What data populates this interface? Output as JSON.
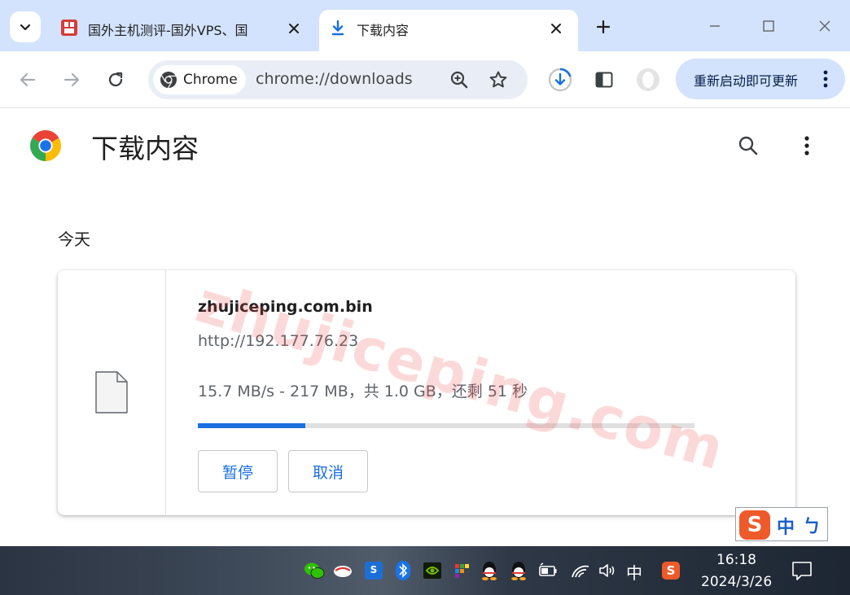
{
  "window": {
    "tabs": [
      {
        "title": "国外主机测评-国外VPS、国",
        "favicon": "site-favicon-icon",
        "active": false
      },
      {
        "title": "下载内容",
        "favicon": "download-icon",
        "active": true
      }
    ]
  },
  "toolbar": {
    "site_chip_label": "Chrome",
    "url": "chrome://downloads",
    "update_button_label": "重新启动即可更新"
  },
  "page": {
    "title": "下载内容",
    "section_label": "今天",
    "download": {
      "file_name": "zhujiceping.com.bin",
      "source_url": "http://192.177.76.23",
      "status": "15.7 MB/s - 217 MB，共 1.0 GB，还剩 51 秒",
      "progress_fraction": 0.217,
      "pause_label": "暂停",
      "cancel_label": "取消"
    }
  },
  "watermark": "zhujiceping.com",
  "ime": {
    "mode_label": "中",
    "punct_label": "ㄅ"
  },
  "taskbar": {
    "input_mode": "中",
    "time": "16:18",
    "date": "2024/3/26"
  },
  "colors": {
    "accent": "#1b6fdf",
    "tabstrip": "#d3e3fd",
    "omnibox": "#e9eef6"
  }
}
